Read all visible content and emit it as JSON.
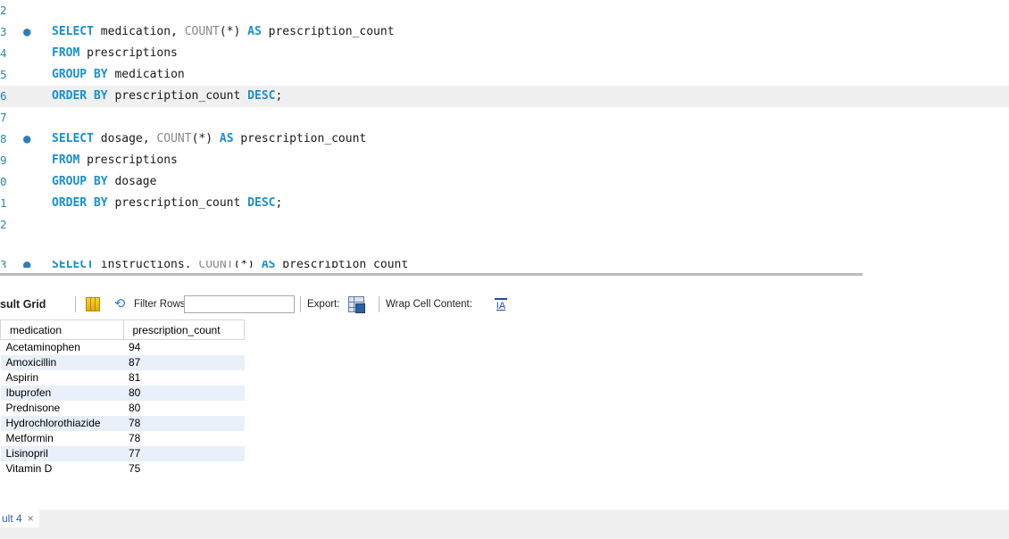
{
  "editor": {
    "lines": [
      {
        "num": "2",
        "dot": false,
        "current": false,
        "tokens": []
      },
      {
        "num": "3",
        "dot": true,
        "current": false,
        "tokens": [
          {
            "t": "SELECT",
            "c": "kw"
          },
          {
            "t": " medication, ",
            "c": ""
          },
          {
            "t": "COUNT",
            "c": "fn"
          },
          {
            "t": "(*) ",
            "c": ""
          },
          {
            "t": "AS",
            "c": "kw"
          },
          {
            "t": " prescription_count",
            "c": ""
          }
        ]
      },
      {
        "num": "4",
        "dot": false,
        "current": false,
        "tokens": [
          {
            "t": "FROM",
            "c": "kw"
          },
          {
            "t": " prescriptions",
            "c": ""
          }
        ]
      },
      {
        "num": "5",
        "dot": false,
        "current": false,
        "tokens": [
          {
            "t": "GROUP BY",
            "c": "kw"
          },
          {
            "t": " medication",
            "c": ""
          }
        ]
      },
      {
        "num": "6",
        "dot": false,
        "current": true,
        "tokens": [
          {
            "t": "ORDER BY",
            "c": "kw"
          },
          {
            "t": " prescription_count ",
            "c": ""
          },
          {
            "t": "DESC",
            "c": "kw"
          },
          {
            "t": ";",
            "c": ""
          }
        ]
      },
      {
        "num": "7",
        "dot": false,
        "current": false,
        "tokens": []
      },
      {
        "num": "8",
        "dot": true,
        "current": false,
        "tokens": [
          {
            "t": "SELECT",
            "c": "kw"
          },
          {
            "t": " dosage, ",
            "c": ""
          },
          {
            "t": "COUNT",
            "c": "fn"
          },
          {
            "t": "(*) ",
            "c": ""
          },
          {
            "t": "AS",
            "c": "kw"
          },
          {
            "t": " prescription_count",
            "c": ""
          }
        ]
      },
      {
        "num": "9",
        "dot": false,
        "current": false,
        "tokens": [
          {
            "t": "FROM",
            "c": "kw"
          },
          {
            "t": " prescriptions",
            "c": ""
          }
        ]
      },
      {
        "num": "0",
        "dot": false,
        "current": false,
        "tokens": [
          {
            "t": "GROUP BY",
            "c": "kw"
          },
          {
            "t": " dosage",
            "c": ""
          }
        ]
      },
      {
        "num": "1",
        "dot": false,
        "current": false,
        "tokens": [
          {
            "t": "ORDER BY",
            "c": "kw"
          },
          {
            "t": " prescription_count ",
            "c": ""
          },
          {
            "t": "DESC",
            "c": "kw"
          },
          {
            "t": ";",
            "c": ""
          }
        ]
      },
      {
        "num": "2",
        "dot": false,
        "current": false,
        "tokens": []
      }
    ],
    "partial_line": {
      "num": "3",
      "dot": true,
      "tokens": [
        {
          "t": "SELECT",
          "c": "kw"
        },
        {
          "t": " instructions, ",
          "c": ""
        },
        {
          "t": "COUNT",
          "c": "fn"
        },
        {
          "t": "(*) ",
          "c": ""
        },
        {
          "t": "AS",
          "c": "kw"
        },
        {
          "t": " prescription_count",
          "c": ""
        }
      ]
    },
    "exec_dot_glyph": "●"
  },
  "toolbar": {
    "result_grid_label": "sult Grid",
    "filter_label": "Filter Rows:",
    "filter_value": "",
    "export_label": "Export:",
    "wrap_label": "Wrap Cell Content:",
    "wrap_icon_glyph": "IA",
    "refresh_glyph": "⟲"
  },
  "grid": {
    "columns": [
      "medication",
      "prescription_count"
    ],
    "rows": [
      [
        "Acetaminophen",
        "94"
      ],
      [
        "Amoxicillin",
        "87"
      ],
      [
        "Aspirin",
        "81"
      ],
      [
        "Ibuprofen",
        "80"
      ],
      [
        "Prednisone",
        "80"
      ],
      [
        "Hydrochlorothiazide",
        "78"
      ],
      [
        "Metformin",
        "78"
      ],
      [
        "Lisinopril",
        "77"
      ],
      [
        "Vitamin D",
        "75"
      ]
    ]
  },
  "tabs": {
    "result_tab_label": "ult 4",
    "close_glyph": "×"
  }
}
